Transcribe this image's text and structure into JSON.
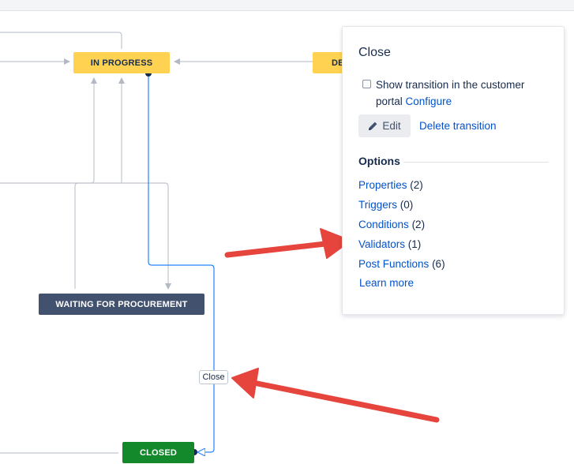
{
  "statuses": {
    "in_progress": "IN PROGRESS",
    "partial_right": "DE",
    "waiting": "WAITING FOR PROCUREMENT",
    "closed": "CLOSED"
  },
  "transition_label": "Close",
  "panel": {
    "title": "Close",
    "checkbox_label": "Show transition in the customer portal",
    "checkbox_checked": false,
    "configure_link": "Configure",
    "edit_button": "Edit",
    "delete_link": "Delete transition",
    "options_heading": "Options",
    "options": [
      {
        "label": "Properties",
        "count": "(2)"
      },
      {
        "label": "Triggers",
        "count": "(0)"
      },
      {
        "label": "Conditions",
        "count": "(2)"
      },
      {
        "label": "Validators",
        "count": "(1)"
      },
      {
        "label": "Post Functions",
        "count": "(6)"
      }
    ],
    "learn_more": "Learn more"
  },
  "colors": {
    "in_progress": "#ffd351",
    "waiting": "#42526e",
    "closed": "#14892c",
    "selected_transition": "#2684ff",
    "link": "#0052cc",
    "annotation_arrow": "#e5453d"
  },
  "icons": {
    "edit": "pencil-icon"
  }
}
